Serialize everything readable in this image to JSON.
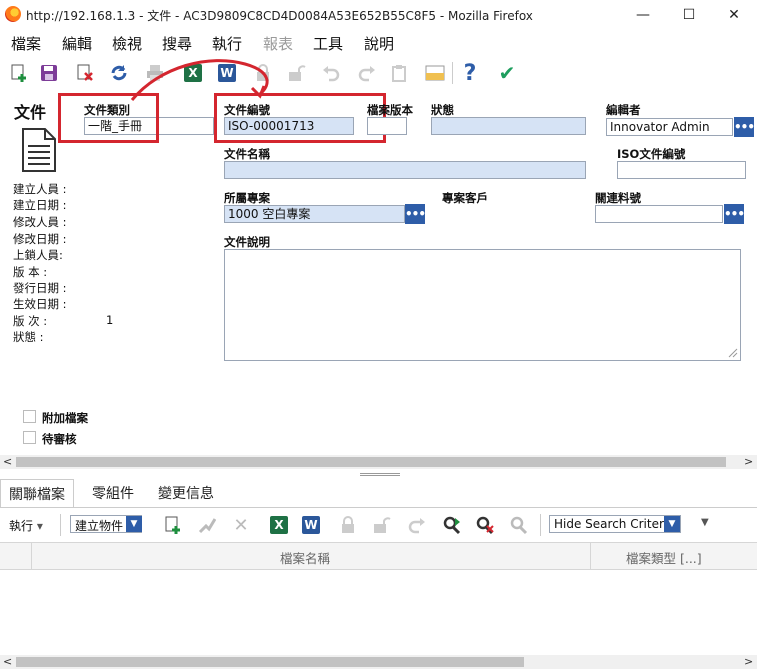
{
  "window": {
    "title": "http://192.168.1.3 - 文件 - AC3D9809C8CD4D0084A53E652B55C8F5 - Mozilla Firefox",
    "minimize_glyph": "—",
    "maximize_glyph": "☐",
    "close_glyph": "✕"
  },
  "menu": {
    "items": [
      {
        "label": "檔案"
      },
      {
        "label": "編輯"
      },
      {
        "label": "檢視"
      },
      {
        "label": "搜尋"
      },
      {
        "label": "執行"
      },
      {
        "label": "報表"
      },
      {
        "label": "工具"
      },
      {
        "label": "說明"
      }
    ]
  },
  "toolbar": {
    "excel_glyph": "X",
    "word_glyph": "W",
    "help_glyph": "?",
    "done_glyph": "✔",
    "icons": [
      "new-item-icon",
      "save-icon",
      "delete-icon",
      "refresh-icon",
      "print-icon",
      "export-excel-icon",
      "export-word-icon",
      "lock-icon",
      "unlock-icon",
      "undo-icon",
      "redo-icon",
      "copy-icon",
      "color-icon",
      "help-icon",
      "done-icon"
    ]
  },
  "item": {
    "type_label": "文件",
    "version_value": "1"
  },
  "sidebar": {
    "labels": [
      "建立人員 :",
      "建立日期 :",
      "修改人員 :",
      "修改日期 :",
      "上鎖人員:",
      "版 本 :",
      "發行日期 :",
      "生效日期 :",
      "版 次 :",
      "狀態 :"
    ]
  },
  "form": {
    "doc_type": {
      "label": "文件類別",
      "value": "一階_手冊"
    },
    "doc_number": {
      "label": "文件編號",
      "value": "ISO-00001713"
    },
    "file_version": {
      "label": "檔案版本",
      "value": ""
    },
    "status": {
      "label": "狀態",
      "value": ""
    },
    "editor": {
      "label": "編輯者",
      "value": "Innovator Admin"
    },
    "doc_name": {
      "label": "文件名稱",
      "value": ""
    },
    "iso_number": {
      "label": "ISO文件編號",
      "value": ""
    },
    "project": {
      "label": "所屬專案",
      "value": "1000 空白專案"
    },
    "customer": {
      "label": "專案客戶"
    },
    "part_number": {
      "label": "關連料號",
      "value": ""
    },
    "description": {
      "label": "文件說明",
      "value": ""
    },
    "dots": "•••",
    "attach_label": "附加檔案",
    "pending_label": "待審核"
  },
  "tabs": [
    {
      "label": "關聯檔案",
      "active": true
    },
    {
      "label": "零組件",
      "active": false
    },
    {
      "label": "變更信息",
      "active": false
    }
  ],
  "relations_toolbar": {
    "actions_label": "執行",
    "actions_arrow": "▾",
    "create_select": "建立物件",
    "search_mode": "Hide Search Criteria",
    "select_arrow": "▼",
    "overflow_arrow": "▼"
  },
  "grid": {
    "columns": [
      "檔案名稱",
      "檔案類型 [...]"
    ]
  },
  "scroll": {
    "left_arrow": "<",
    "right_arrow": ">"
  },
  "colors": {
    "accent_blue": "#2e5da8",
    "readonly_field": "#d6e3f5",
    "annotation_red": "#d4262f"
  }
}
